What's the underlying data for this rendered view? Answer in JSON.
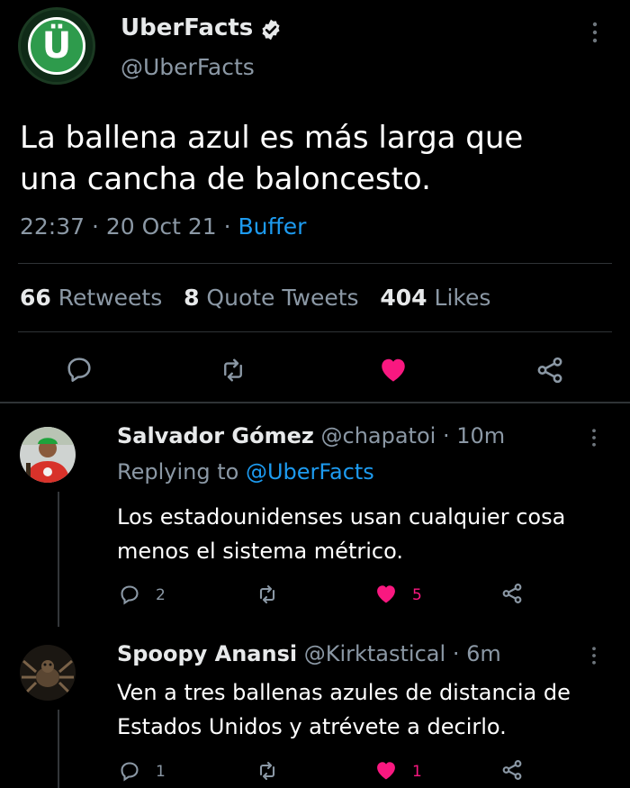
{
  "tweet": {
    "avatar_letter": "Ü",
    "name": "UberFacts",
    "handle": "@UberFacts",
    "text_line1": "La ballena azul es más larga que",
    "text_line2": "una cancha de baloncesto.",
    "time": "22:37",
    "date": "20 Oct 21",
    "source": "Buffer",
    "retweets_count": "66",
    "retweets_label": "Retweets",
    "quotes_count": "8",
    "quotes_label": "Quote Tweets",
    "likes_count": "404",
    "likes_label": "Likes",
    "accent_like_color": "#f91880",
    "accent_link_color": "#1d9bf0"
  },
  "replies": [
    {
      "name": "Salvador Gómez",
      "handle": "@chapatoi",
      "time": "10m",
      "replying_label": "Replying to",
      "replying_to": "@UberFacts",
      "text_line1": "Los estadounidenses usan cualquier cosa",
      "text_line2": "menos el sistema métrico.",
      "replies_count": "2",
      "likes_count": "5"
    },
    {
      "name": "Spoopy Anansi",
      "handle": "@Kirktastical",
      "time": "6m",
      "text_line1": "Ven a tres ballenas azules de distancia de",
      "text_line2": "Estados Unidos y atrévete a decirlo.",
      "replies_count": "1",
      "likes_count": "1"
    }
  ],
  "separator": "·"
}
